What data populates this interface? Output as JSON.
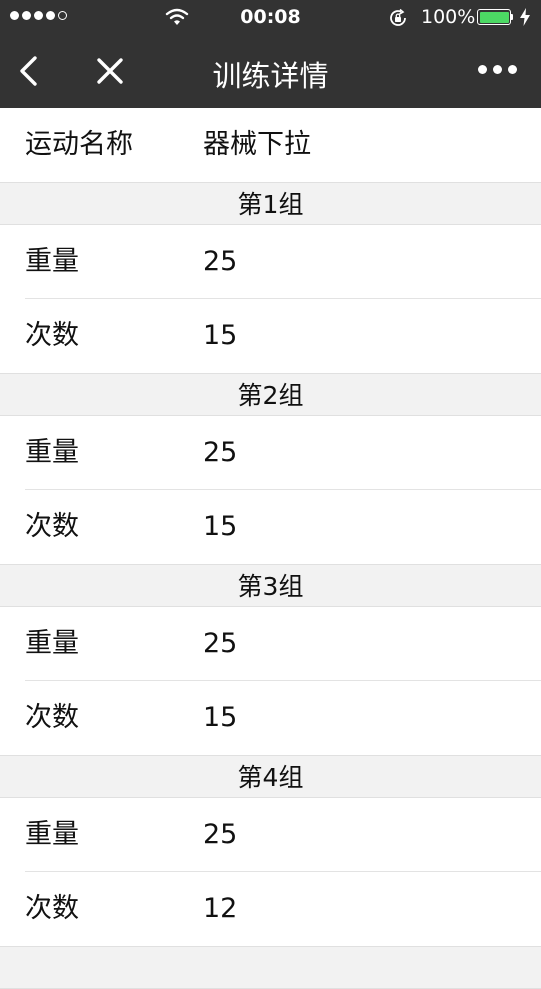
{
  "status_bar": {
    "time": "00:08",
    "battery_percent": "100%",
    "battery_level": 1.0,
    "battery_color": "#4cd964",
    "signal_bars_filled": 4,
    "signal_bars_total": 5
  },
  "nav": {
    "title": "训练详情",
    "background": "#333333",
    "back_icon": "chevron-left-icon",
    "close_icon": "close-icon",
    "more_icon": "more-dots-icon"
  },
  "exercise": {
    "label": "运动名称",
    "value": "器械下拉"
  },
  "groups": [
    {
      "title": "第1组",
      "weight_label": "重量",
      "weight": "25",
      "reps_label": "次数",
      "reps": "15"
    },
    {
      "title": "第2组",
      "weight_label": "重量",
      "weight": "25",
      "reps_label": "次数",
      "reps": "15"
    },
    {
      "title": "第3组",
      "weight_label": "重量",
      "weight": "25",
      "reps_label": "次数",
      "reps": "15"
    },
    {
      "title": "第4组",
      "weight_label": "重量",
      "weight": "25",
      "reps_label": "次数",
      "reps": "12"
    }
  ]
}
